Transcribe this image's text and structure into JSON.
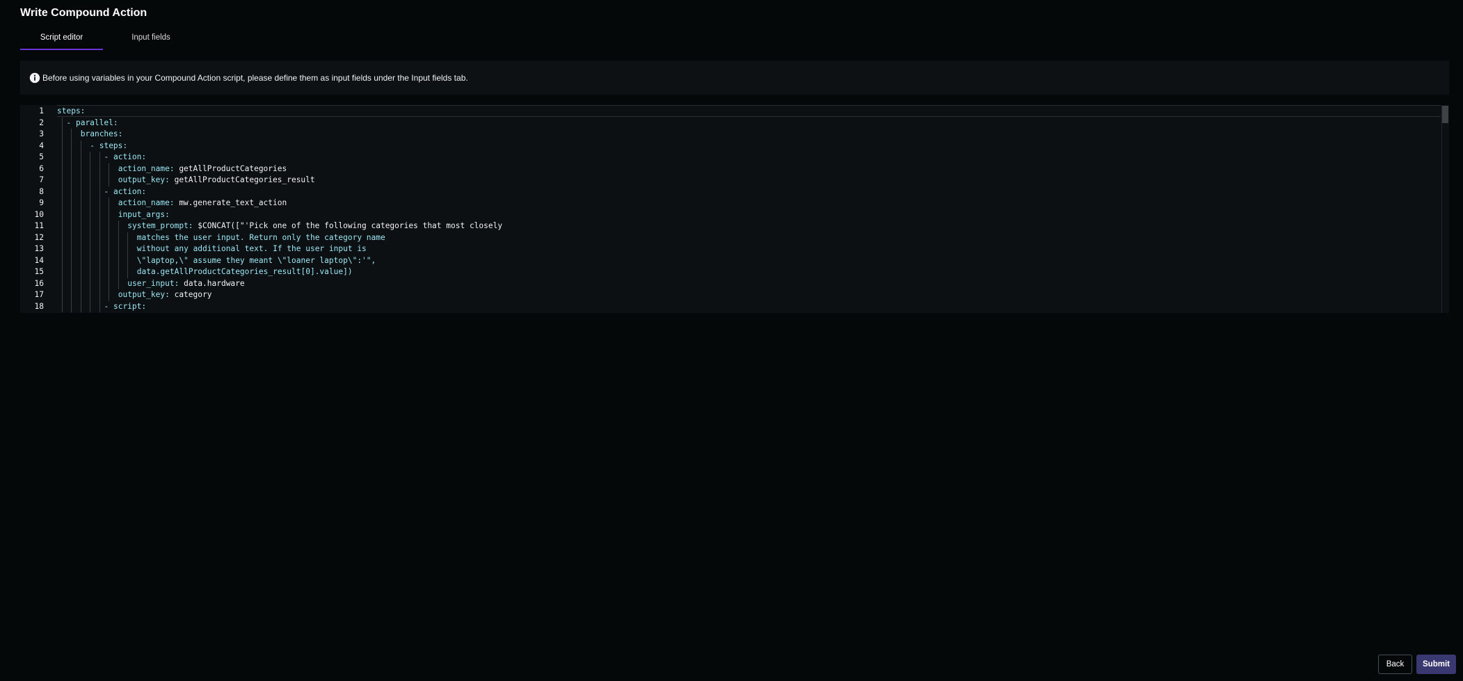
{
  "page": {
    "title": "Write Compound Action"
  },
  "tabs": [
    {
      "label": "Script editor",
      "active": true
    },
    {
      "label": "Input fields",
      "active": false
    }
  ],
  "banner": {
    "icon": "info-icon",
    "text": "Before using variables in your Compound Action script, please define them as input fields under the Input fields tab."
  },
  "editor": {
    "lines": [
      {
        "n": "1",
        "key": "steps:",
        "val": ""
      },
      {
        "n": "2",
        "key": "- parallel:",
        "val": ""
      },
      {
        "n": "3",
        "key": "branches:",
        "val": ""
      },
      {
        "n": "4",
        "key": "- steps:",
        "val": ""
      },
      {
        "n": "5",
        "key": "- action:",
        "val": ""
      },
      {
        "n": "6",
        "key": "action_name:",
        "val": " getAllProductCategories"
      },
      {
        "n": "7",
        "key": "output_key:",
        "val": " getAllProductCategories_result"
      },
      {
        "n": "8",
        "key": "- action:",
        "val": ""
      },
      {
        "n": "9",
        "key": "action_name:",
        "val": " mw.generate_text_action"
      },
      {
        "n": "10",
        "key": "input_args:",
        "val": ""
      },
      {
        "n": "11",
        "key": "system_prompt:",
        "val": " $CONCAT([\"'Pick one of the following categories that most closely"
      },
      {
        "n": "12",
        "key": "",
        "val": "matches the user input. Return only the category name"
      },
      {
        "n": "13",
        "key": "",
        "val": "without any additional text. If the user input is"
      },
      {
        "n": "14",
        "key": "",
        "val": "\\\"laptop,\\\" assume they meant \\\"loaner laptop\\\":'\","
      },
      {
        "n": "15",
        "key": "",
        "val": "data.getAllProductCategories_result[0].value])"
      },
      {
        "n": "16",
        "key": "user_input:",
        "val": " data.hardware"
      },
      {
        "n": "17",
        "key": "output_key:",
        "val": " category"
      },
      {
        "n": "18",
        "key": "- script:",
        "val": ""
      }
    ]
  },
  "footer": {
    "back_label": "Back",
    "submit_label": "Submit"
  }
}
